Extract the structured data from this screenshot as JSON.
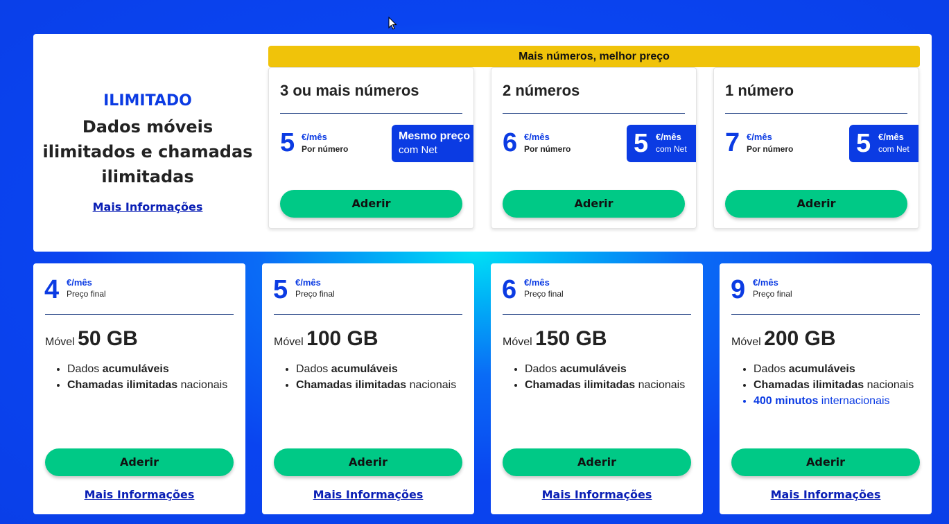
{
  "promo": {
    "tag": "ILIMITADO",
    "title": "Dados móveis ilimitados e chamadas ilimitadas",
    "link": "Mais Informações"
  },
  "banner": "Mais números, melhor preço",
  "multi_cards": [
    {
      "title": "3 ou mais números",
      "price": "5",
      "unit": "€/mês",
      "sub": "Por número",
      "net_line1": "Mesmo preço",
      "net_line2": "com Net",
      "button": "Aderir"
    },
    {
      "title": "2 números",
      "price": "6",
      "unit": "€/mês",
      "sub": "Por número",
      "net_price": "5",
      "net_unit": "€/mês",
      "net_sub": "com Net",
      "button": "Aderir"
    },
    {
      "title": "1 número",
      "price": "7",
      "unit": "€/mês",
      "sub": "Por número",
      "net_price": "5",
      "net_unit": "€/mês",
      "net_sub": "com Net",
      "button": "Aderir"
    }
  ],
  "plans": [
    {
      "price": "4",
      "unit": "€/mês",
      "sub": "Preço final",
      "label": "Móvel",
      "data": "50 GB",
      "f1_a": "Dados ",
      "f1_b": "acumuláveis",
      "f2_a": "Chamadas ilimitadas",
      "f2_b": " nacionais",
      "button": "Aderir",
      "link": "Mais Informações"
    },
    {
      "price": "5",
      "unit": "€/mês",
      "sub": "Preço final",
      "label": "Móvel",
      "data": "100 GB",
      "f1_a": "Dados ",
      "f1_b": "acumuláveis",
      "f2_a": "Chamadas ilimitadas",
      "f2_b": " nacionais",
      "button": "Aderir",
      "link": "Mais Informações"
    },
    {
      "price": "6",
      "unit": "€/mês",
      "sub": "Preço final",
      "label": "Móvel",
      "data": "150 GB",
      "f1_a": "Dados ",
      "f1_b": "acumuláveis",
      "f2_a": "Chamadas ilimitadas",
      "f2_b": " nacionais",
      "button": "Aderir",
      "link": "Mais Informações"
    },
    {
      "price": "9",
      "unit": "€/mês",
      "sub": "Preço final",
      "label": "Móvel",
      "data": "200 GB",
      "f1_a": "Dados ",
      "f1_b": "acumuláveis",
      "f2_a": "Chamadas ilimitadas",
      "f2_b": " nacionais",
      "f3_a": "400 minutos",
      "f3_b": " internacionais",
      "button": "Aderir",
      "link": "Mais Informações"
    }
  ],
  "colors": {
    "accent_blue": "#0b3be3",
    "button_green": "#00c986",
    "banner_yellow": "#f0c30a",
    "link_blue": "#0a1fb5"
  }
}
